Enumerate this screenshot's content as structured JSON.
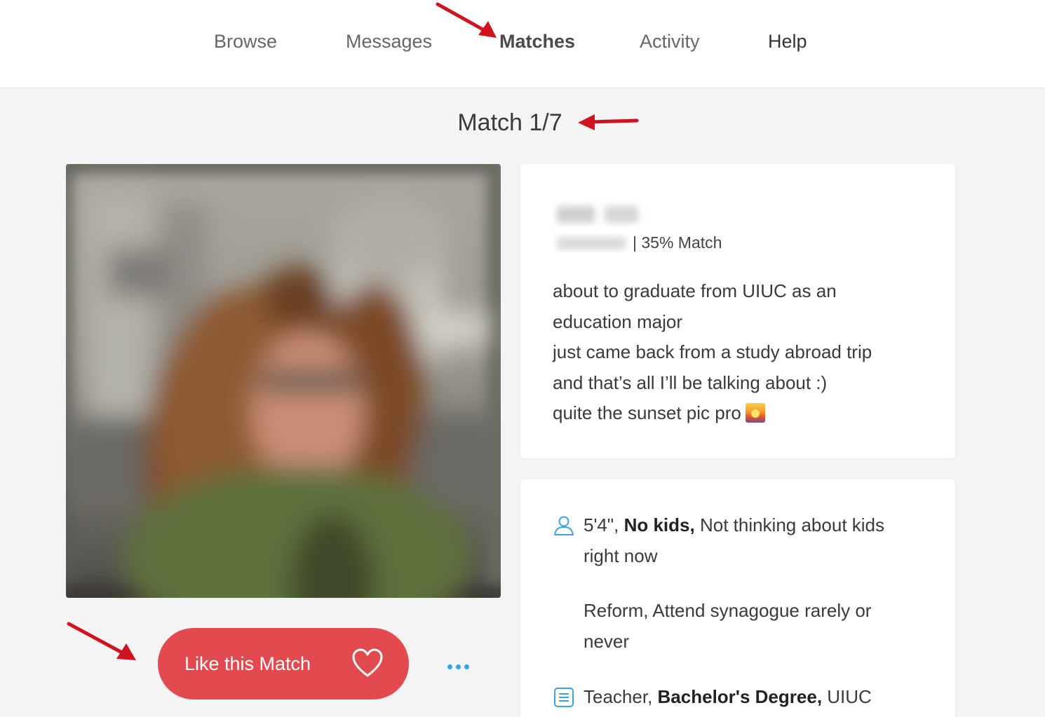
{
  "nav": {
    "items": [
      "Browse",
      "Messages",
      "Matches",
      "Activity",
      "Help"
    ],
    "active": "Matches"
  },
  "match_counter": "Match 1/7",
  "profile": {
    "match_percent_text": "| 35% Match",
    "bio_lines": [
      "about to graduate from UIUC as an",
      "education major",
      "just came back from a study abroad trip",
      "and that’s all I’ll be talking about :)",
      "quite the sunset pic pro"
    ],
    "bio_emoji": "sunset-emoji"
  },
  "details": {
    "basics": {
      "icon": "person-icon",
      "height": "5'4\",",
      "kids_bold": "No kids,",
      "kids_text": "Not thinking about kids",
      "kids_text_2": "right now"
    },
    "religion": {
      "line1": "Reform, Attend synagogue rarely or",
      "line2": "never"
    },
    "work": {
      "icon": "document-icon",
      "job": "Teacher,",
      "degree_bold": "Bachelor's Degree,",
      "school": "UIUC"
    }
  },
  "actions": {
    "like_label": "Like this Match",
    "like_icon": "heart-icon",
    "more_icon": "more-dots-icon"
  },
  "colors": {
    "accent_red": "#e24a50",
    "link_blue": "#3aa3e0",
    "page_bg": "#f4f4f4"
  }
}
